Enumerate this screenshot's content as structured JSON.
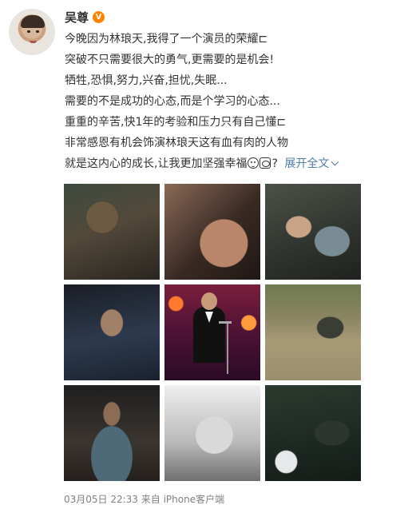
{
  "user": {
    "name": "吴尊",
    "verified_icon": "verified-badge-icon",
    "badge_color": "#ff8200"
  },
  "post": {
    "lines": [
      "今晚因为林琅天,我得了一个演员的荣耀⊏",
      "突破不只需要很大的勇气,更需要的是机会!",
      "牺牲,恐惧,努力,兴奋,担忧,失眠...",
      "需要的不是成功的心态,而是个学习的心态...",
      "重重的辛苦,快1年的考验和压力只有自己懂⊏",
      "非常感恩有机会饰演林琅天这有血有肉的人物"
    ],
    "last_line": "就是这内心的成长,让我更加坚强幸福",
    "last_line_suffix": "?",
    "expand_label": "展开全文",
    "link_color": "#507daf"
  },
  "photos": [
    {
      "icon": "photo-1"
    },
    {
      "icon": "photo-2"
    },
    {
      "icon": "photo-3"
    },
    {
      "icon": "photo-4"
    },
    {
      "icon": "photo-5"
    },
    {
      "icon": "photo-6"
    },
    {
      "icon": "photo-7"
    },
    {
      "icon": "photo-8"
    },
    {
      "icon": "photo-9"
    }
  ],
  "footer": {
    "meta": "03月05日 22:33 来自 iPhone客户端"
  }
}
